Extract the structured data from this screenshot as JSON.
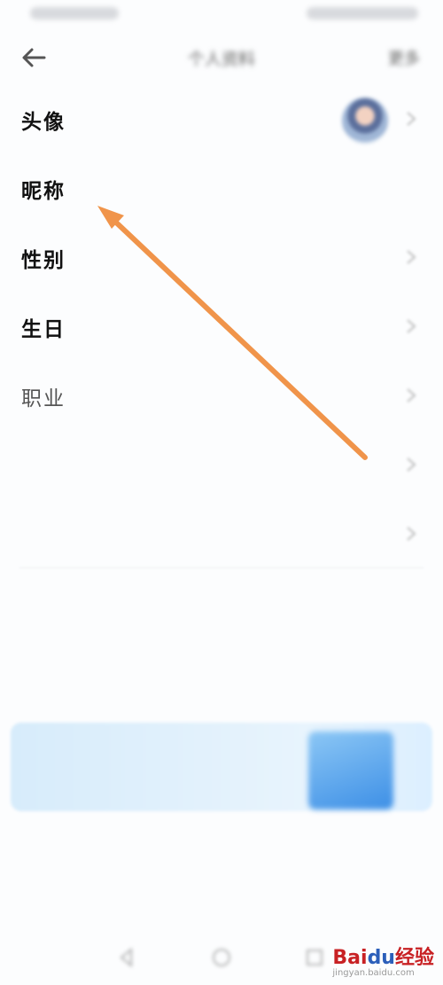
{
  "status_bar": {
    "left": "",
    "right": ""
  },
  "header": {
    "title": "个人资料",
    "more": "更多"
  },
  "rows": {
    "avatar": {
      "label": "头像"
    },
    "nickname": {
      "label": "昵称",
      "value": ""
    },
    "gender": {
      "label": "性别",
      "value": ""
    },
    "birthday": {
      "label": "生日",
      "value": ""
    },
    "occupation": {
      "label": "职业",
      "value": ""
    },
    "wechat": {
      "label": "",
      "value": ""
    },
    "weibo": {
      "label": "",
      "value": ""
    }
  },
  "prompt": {
    "text": ""
  },
  "small_link": "",
  "banner": {
    "title": "",
    "subtitle": ""
  },
  "faint_text": "",
  "watermark": {
    "brand_a": "Bai",
    "brand_paw": "du",
    "brand_b": "经验",
    "url": "jingyan.baidu.com"
  },
  "colors": {
    "arrow": "#f0944a",
    "link": "#4a9be8",
    "banner_bg": "#e3f1fd"
  },
  "icons": [
    "back-arrow-icon",
    "chevron-right-icon",
    "avatar-image",
    "baidu-logo-icon"
  ]
}
